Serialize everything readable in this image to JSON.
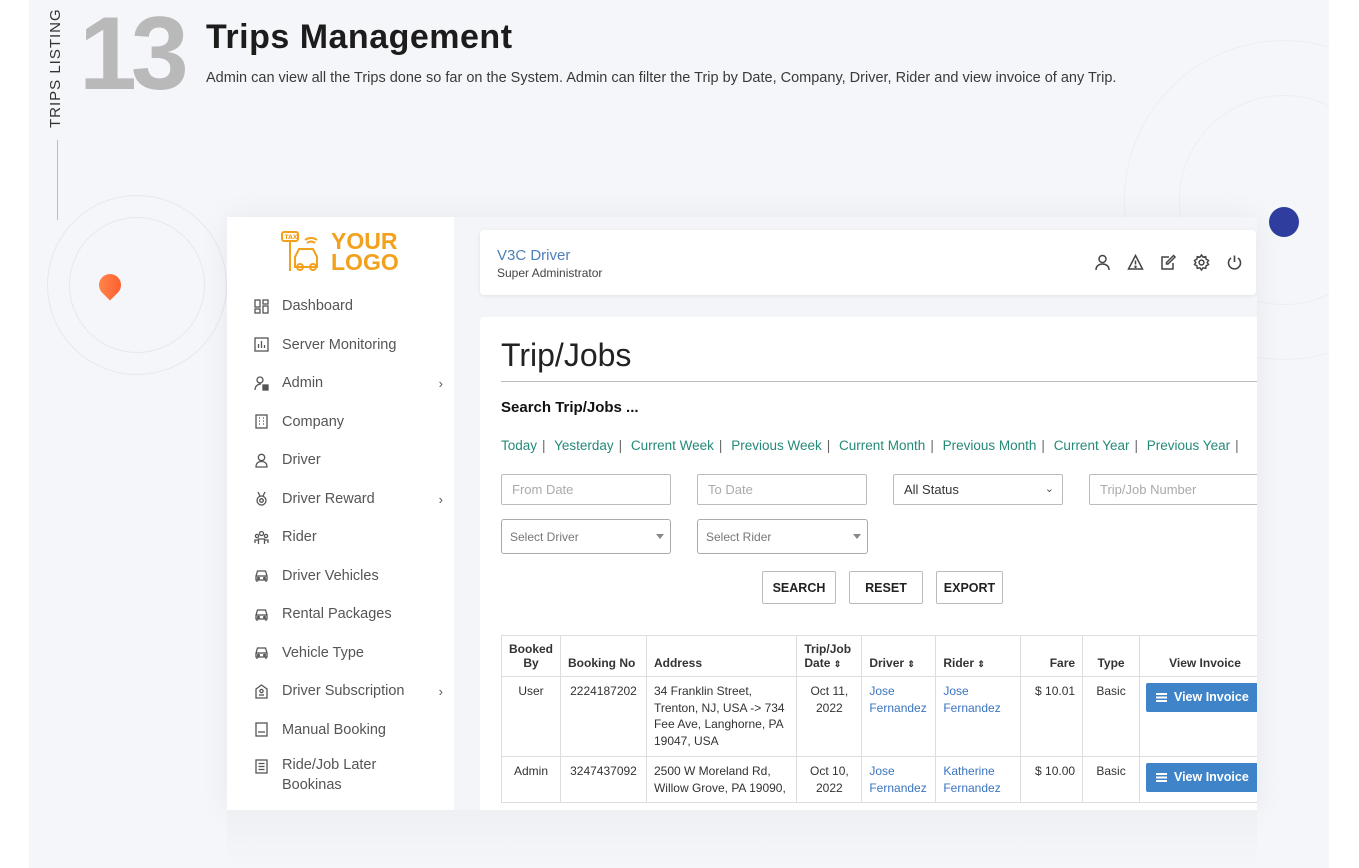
{
  "section": {
    "vertical_label": "TRIPS LISTING",
    "number": "13",
    "title": "Trips Management",
    "description": "Admin can view all the Trips done so far on the System. Admin can filter the Trip by Date, Company, Driver, Rider and view invoice of any Trip."
  },
  "logo": {
    "line1": "YOUR",
    "line2": "LOGO",
    "color": "#f3a11d"
  },
  "sidebar": {
    "items": [
      {
        "label": "Dashboard",
        "icon": "dashboard-icon",
        "chevron": false
      },
      {
        "label": "Server Monitoring",
        "icon": "chart-icon",
        "chevron": false
      },
      {
        "label": "Admin",
        "icon": "admin-user-icon",
        "chevron": true
      },
      {
        "label": "Company",
        "icon": "building-icon",
        "chevron": false
      },
      {
        "label": "Driver",
        "icon": "driver-icon",
        "chevron": false
      },
      {
        "label": "Driver Reward",
        "icon": "medal-icon",
        "chevron": true
      },
      {
        "label": "Rider",
        "icon": "group-icon",
        "chevron": false
      },
      {
        "label": "Driver Vehicles",
        "icon": "car-icon",
        "chevron": false
      },
      {
        "label": "Rental Packages",
        "icon": "car-icon",
        "chevron": false
      },
      {
        "label": "Vehicle Type",
        "icon": "car-icon",
        "chevron": false
      },
      {
        "label": "Driver Subscription",
        "icon": "subscription-icon",
        "chevron": true
      },
      {
        "label": "Manual Booking",
        "icon": "booking-icon",
        "chevron": false
      },
      {
        "label": "Ride/Job Later Bookinas",
        "icon": "list-doc-icon",
        "chevron": false
      }
    ]
  },
  "topbar": {
    "app_name": "V3C Driver",
    "role": "Super Administrator",
    "icons": [
      "user-icon",
      "alert-icon",
      "edit-icon",
      "gear-icon",
      "power-icon"
    ]
  },
  "page": {
    "title": "Trip/Jobs",
    "search_heading": "Search Trip/Jobs ...",
    "quick_filters": [
      "Today",
      "Yesterday",
      "Current Week",
      "Previous Week",
      "Current Month",
      "Previous Month",
      "Current Year",
      "Previous Year"
    ],
    "from_date_placeholder": "From Date",
    "to_date_placeholder": "To Date",
    "status_value": "All Status",
    "trip_number_placeholder": "Trip/Job Number",
    "select_driver": "Select Driver",
    "select_rider": "Select Rider",
    "buttons": {
      "search": "SEARCH",
      "reset": "RESET",
      "export": "EXPORT"
    }
  },
  "table": {
    "headers": {
      "booked_by": "Booked By",
      "booking_no": "Booking No",
      "address": "Address",
      "trip_date": "Trip/Job Date",
      "driver": "Driver",
      "rider": "Rider",
      "fare": "Fare",
      "type": "Type",
      "view_invoice": "View Invoice"
    },
    "rows": [
      {
        "booked_by": "User",
        "booking_no": "2224187202",
        "address": "34 Franklin Street, Trenton, NJ, USA -> 734 Fee Ave, Langhorne, PA 19047, USA",
        "date": "Oct 11, 2022",
        "driver": "Jose Fernandez",
        "rider": "Jose Fernandez",
        "fare": "$ 10.01",
        "type": "Basic",
        "invoice_label": "View Invoice"
      },
      {
        "booked_by": "Admin",
        "booking_no": "3247437092",
        "address": "2500 W Moreland Rd, Willow Grove, PA 19090,",
        "date": "Oct 10, 2022",
        "driver": "Jose Fernandez",
        "rider": "Katherine Fernandez",
        "fare": "$ 10.00",
        "type": "Basic",
        "invoice_label": "View Invoice"
      }
    ]
  },
  "colors": {
    "accent_link": "#3a74c0",
    "quick_filter": "#258a78",
    "invoice_button": "#3f83c9",
    "number_gray": "#b9b9b9"
  }
}
